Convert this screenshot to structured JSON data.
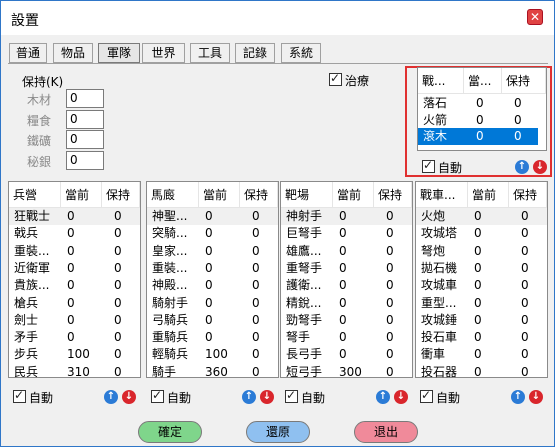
{
  "window": {
    "title": "設置",
    "close_icon": "close-icon"
  },
  "tabs": [
    {
      "label": "普通"
    },
    {
      "label": "物品"
    },
    {
      "label": "軍隊"
    },
    {
      "label": "世界"
    },
    {
      "label": "工具"
    },
    {
      "label": "記錄"
    },
    {
      "label": "系統"
    }
  ],
  "active_tab": "軍隊",
  "resources": {
    "group_label": "保持(K)",
    "items": [
      {
        "label": "木材",
        "value": "0"
      },
      {
        "label": "糧食",
        "value": "0"
      },
      {
        "label": "鐵礦",
        "value": "0"
      },
      {
        "label": "秘銀",
        "value": "0"
      }
    ]
  },
  "heal": {
    "label": "治療",
    "checked": true
  },
  "siege_top": {
    "headers": [
      "戰...",
      "當...",
      "保持"
    ],
    "rows": [
      {
        "name": "落石",
        "cur": "0",
        "keep": "0"
      },
      {
        "name": "火箭",
        "cur": "0",
        "keep": "0"
      },
      {
        "name": "滾木",
        "cur": "0",
        "keep": "0",
        "selected": true
      }
    ],
    "auto_label": "自動"
  },
  "panels": [
    {
      "id": "barracks",
      "headers": [
        "兵營",
        "當前",
        "保持"
      ],
      "rows": [
        [
          "狂戰士",
          "0",
          "0"
        ],
        [
          "戟兵",
          "0",
          "0"
        ],
        [
          "重裝...",
          "0",
          "0"
        ],
        [
          "近衛軍",
          "0",
          "0"
        ],
        [
          "貴族...",
          "0",
          "0"
        ],
        [
          "槍兵",
          "0",
          "0"
        ],
        [
          "劍士",
          "0",
          "0"
        ],
        [
          "矛手",
          "0",
          "0"
        ],
        [
          "步兵",
          "100",
          "0"
        ],
        [
          "民兵",
          "310",
          "0"
        ]
      ],
      "auto_label": "自動"
    },
    {
      "id": "stable",
      "headers": [
        "馬廄",
        "當前",
        "保持"
      ],
      "rows": [
        [
          "神聖...",
          "0",
          "0"
        ],
        [
          "突騎...",
          "0",
          "0"
        ],
        [
          "皇家...",
          "0",
          "0"
        ],
        [
          "重裝...",
          "0",
          "0"
        ],
        [
          "神殿...",
          "0",
          "0"
        ],
        [
          "騎射手",
          "0",
          "0"
        ],
        [
          "弓騎兵",
          "0",
          "0"
        ],
        [
          "重騎兵",
          "0",
          "0"
        ],
        [
          "輕騎兵",
          "100",
          "0"
        ],
        [
          "騎手",
          "360",
          "0"
        ]
      ],
      "auto_label": "自動"
    },
    {
      "id": "range",
      "headers": [
        "靶場",
        "當前",
        "保持"
      ],
      "rows": [
        [
          "神射手",
          "0",
          "0"
        ],
        [
          "巨弩手",
          "0",
          "0"
        ],
        [
          "雄鷹...",
          "0",
          "0"
        ],
        [
          "重弩手",
          "0",
          "0"
        ],
        [
          "護衛...",
          "0",
          "0"
        ],
        [
          "精銳...",
          "0",
          "0"
        ],
        [
          "勁弩手",
          "0",
          "0"
        ],
        [
          "弩手",
          "0",
          "0"
        ],
        [
          "長弓手",
          "0",
          "0"
        ],
        [
          "短弓手",
          "300",
          "0"
        ]
      ],
      "auto_label": "自動"
    },
    {
      "id": "siege",
      "headers": [
        "戰車...",
        "當前",
        "保持"
      ],
      "rows": [
        [
          "火炮",
          "0",
          "0"
        ],
        [
          "攻城塔",
          "0",
          "0"
        ],
        [
          "弩炮",
          "0",
          "0"
        ],
        [
          "拋石機",
          "0",
          "0"
        ],
        [
          "攻城車",
          "0",
          "0"
        ],
        [
          "重型...",
          "0",
          "0"
        ],
        [
          "攻城錘",
          "0",
          "0"
        ],
        [
          "投石車",
          "0",
          "0"
        ],
        [
          "衝車",
          "0",
          "0"
        ],
        [
          "投石器",
          "0",
          "0"
        ]
      ],
      "auto_label": "自動"
    }
  ],
  "buttons": {
    "ok": "確定",
    "restore": "還原",
    "exit": "退出"
  },
  "colors": {
    "selection": "#0078d7",
    "highlight_box": "#e03030",
    "ok": "#7fd58b",
    "restore": "#8fc0f0",
    "exit": "#f08a9a"
  }
}
